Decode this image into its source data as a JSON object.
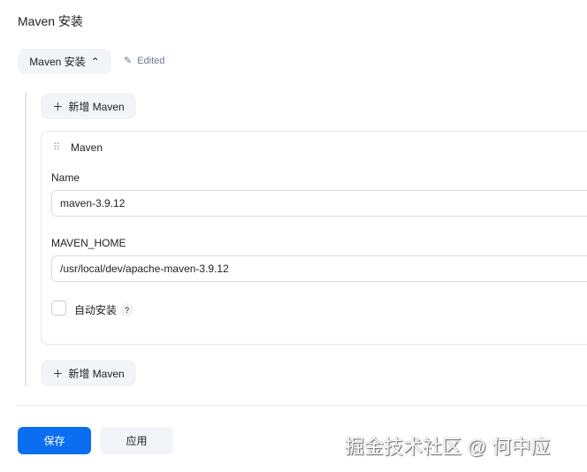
{
  "page_title": "Maven 安装",
  "section_toggle": {
    "label": "Maven 安装",
    "edited": "Edited"
  },
  "add_button": "新增 Maven",
  "card": {
    "title": "Maven",
    "name_label": "Name",
    "name_value": "maven-3.9.12",
    "home_label": "MAVEN_HOME",
    "home_value": "/usr/local/dev/apache-maven-3.9.12",
    "auto_install_label": "自动安装",
    "help": "?"
  },
  "footer": {
    "save": "保存",
    "apply": "应用"
  },
  "watermark": "掘金技术社区 @ 何中应"
}
